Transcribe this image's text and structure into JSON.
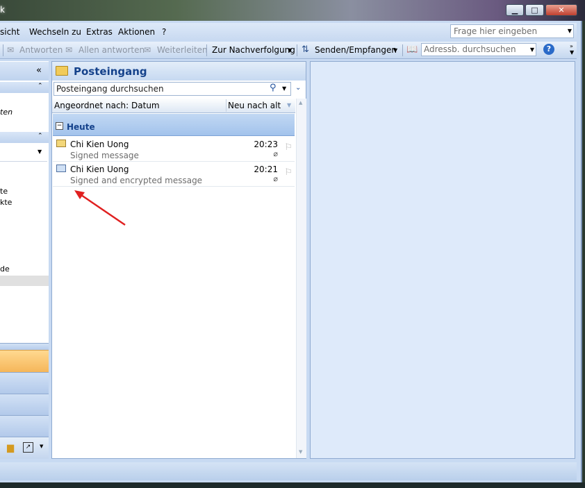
{
  "window": {
    "title_fragment": "k"
  },
  "menu": {
    "items": [
      "sicht",
      "Wechseln zu",
      "Extras",
      "Aktionen",
      "?"
    ],
    "ask_placeholder": "Frage hier eingeben"
  },
  "toolbar": {
    "reply": "Antworten",
    "reply_all": "Allen antworten",
    "forward": "Weiterleiten",
    "followup": "Zur Nachverfolgung",
    "send_receive": "Senden/Empfangen",
    "address_search_placeholder": "Adressb. durchsuchen"
  },
  "nav": {
    "collapse": "«",
    "fragments": [
      "ten",
      "te",
      "kte",
      "de"
    ]
  },
  "folder": {
    "title": "Posteingang",
    "search_placeholder": "Posteingang durchsuchen",
    "arranged_by": "Angeordnet nach: Datum",
    "sort_order": "Neu nach alt",
    "group": "Heute"
  },
  "messages": [
    {
      "sender": "Chi Kien Uong",
      "subject": "Signed message",
      "time": "20:23"
    },
    {
      "sender": "Chi Kien Uong",
      "subject": "Signed and encrypted message",
      "time": "20:21"
    }
  ],
  "colors": {
    "accent": "#15428b",
    "annotation_arrow": "#e02020"
  }
}
